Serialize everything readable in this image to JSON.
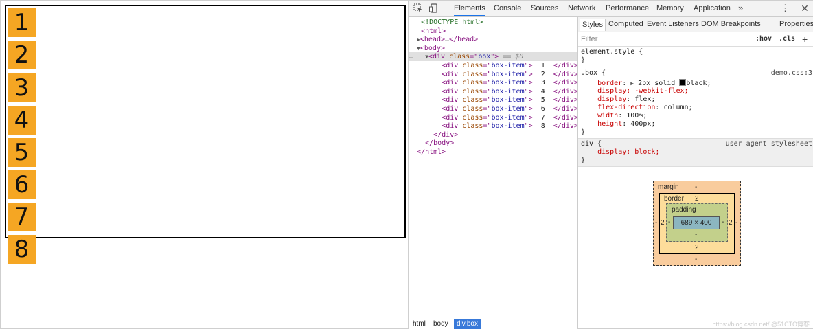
{
  "preview": {
    "box_items": [
      "1",
      "2",
      "3",
      "4",
      "5",
      "6",
      "7",
      "8"
    ],
    "accent_color": "#f5a623"
  },
  "toolbar": {
    "inspect_icon": "inspect-cursor-icon",
    "device_icon": "device-toggle-icon",
    "tabs": [
      "Elements",
      "Console",
      "Sources",
      "Network",
      "Performance",
      "Memory",
      "Application"
    ],
    "more_label": "»",
    "kebab_label": "⋮",
    "close_label": "✕"
  },
  "dom": {
    "doctype": "<!DOCTYPE html>",
    "html_open": "<html>",
    "head_open": "<head>",
    "head_ellipsis": "…",
    "head_close": "</head>",
    "body_open": "<body>",
    "div_prefix": "<div ",
    "div_attr": "class",
    "div_eq": "=\"",
    "div_value": "box",
    "div_suffix": "\">",
    "div_selected_marker": " == $0",
    "row_dots": "…",
    "item_class": "box-item",
    "items": [
      "1",
      "2",
      "3",
      "4",
      "5",
      "6",
      "7",
      "8"
    ],
    "div_close": "</div>",
    "body_close": "</body>",
    "html_close": "</html>"
  },
  "breadcrumbs": [
    "html",
    "body",
    "div.box"
  ],
  "styles": {
    "subtabs": [
      "Styles",
      "Computed",
      "Event Listeners",
      "DOM Breakpoints",
      "Properties"
    ],
    "filter_placeholder": "Filter",
    "hov_label": ":hov",
    "cls_label": ".cls",
    "plus_label": "+",
    "element_style_selector": "element.style {",
    "close_brace": "}",
    "box_selector": ".box {",
    "box_source": "demo.css:3",
    "box_decls": {
      "border_name": "border",
      "border_value_a": "2px solid",
      "border_value_b": "black;",
      "display_webkit": "display: -webkit-flex;",
      "display_flex_name": "display",
      "display_flex_value": "flex;",
      "flex_direction_name": "flex-direction",
      "flex_direction_value": "column;",
      "width_name": "width",
      "width_value": "100%;",
      "height_name": "height",
      "height_value": "400px;"
    },
    "ua_selector": "div {",
    "ua_source": "user agent stylesheet",
    "ua_decl": "display: block;"
  },
  "box_model": {
    "margin_label": "margin",
    "margin_top": "-",
    "margin_bottom": "-",
    "margin_left": "-",
    "margin_right": "-",
    "border_label": "border",
    "border_top": "2",
    "border_bottom": "2",
    "border_left": "2",
    "border_right": "2",
    "padding_label": "padding",
    "padding_top": "-",
    "padding_bottom": "-",
    "padding_left": "-",
    "padding_right": "-",
    "content_size": "689 × 400"
  },
  "watermark": "https://blog.csdn.net/  @51CTO博客"
}
